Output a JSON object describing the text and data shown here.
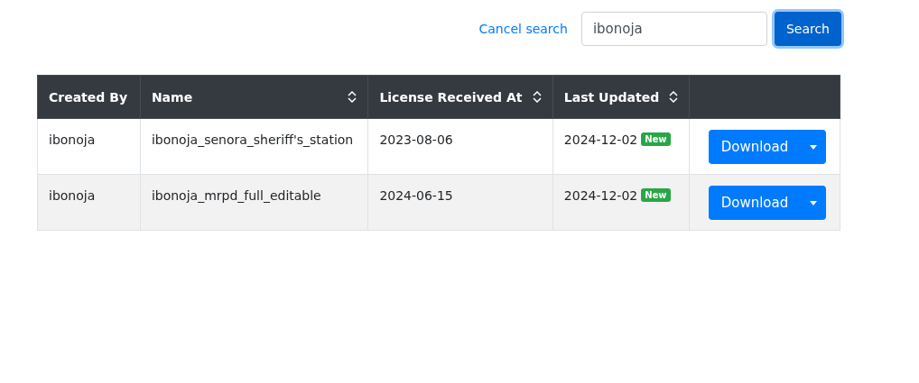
{
  "search": {
    "cancel_label": "Cancel search",
    "value": "ibonoja",
    "button_label": "Search"
  },
  "table": {
    "columns": [
      {
        "label": "Created By",
        "sortable": false
      },
      {
        "label": "Name",
        "sortable": true
      },
      {
        "label": "License Received At",
        "sortable": true
      },
      {
        "label": "Last Updated",
        "sortable": true
      },
      {
        "sortable": false
      }
    ],
    "rows": [
      {
        "created_by": "ibonoja",
        "name": "ibonoja_senora_sheriff's_station",
        "license_received_at": "2023-08-06",
        "last_updated": "2024-12-02",
        "badge": "New",
        "action": "Download"
      },
      {
        "created_by": "ibonoja",
        "name": "ibonoja_mrpd_full_editable",
        "license_received_at": "2024-06-15",
        "last_updated": "2024-12-02",
        "badge": "New",
        "action": "Download"
      }
    ]
  }
}
